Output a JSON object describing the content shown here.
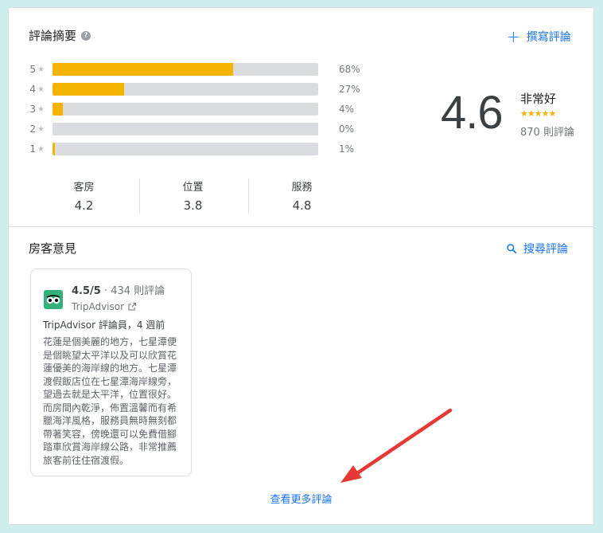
{
  "summary": {
    "title": "評論摘要",
    "write_review": "撰寫評論",
    "bars": [
      {
        "stars": "5",
        "percent_label": "68%",
        "percent": 68
      },
      {
        "stars": "4",
        "percent_label": "27%",
        "percent": 27
      },
      {
        "stars": "3",
        "percent_label": "4%",
        "percent": 4
      },
      {
        "stars": "2",
        "percent_label": "0%",
        "percent": 0
      },
      {
        "stars": "1",
        "percent_label": "1%",
        "percent": 1
      }
    ],
    "star_glyph": "★",
    "score": "4.6",
    "score_label": "非常好",
    "stars_display": "★★★★★",
    "star_rating": 4.6,
    "review_count": "870 則評論",
    "categories": [
      {
        "name": "客房",
        "value": "4.2"
      },
      {
        "name": "位置",
        "value": "3.8"
      },
      {
        "name": "服務",
        "value": "4.8"
      }
    ]
  },
  "opinions": {
    "title": "房客意見",
    "search_reviews": "搜尋評論",
    "card": {
      "rating": "4.5/5",
      "count": " · 434 則評論",
      "source": "TripAdvisor",
      "author": "TripAdvisor 評論員，4 週前",
      "text": "花蓮是個美麗的地方，七星潭便是個眺望太平洋以及可以欣賞花蓮優美的海岸線的地方。七星潭渡假飯店位在七星潭海岸線旁，望過去就是太平洋，位置很好。而房間內乾淨，佈置溫馨而有希臘海洋風格，服務員無時無刻都帶著笑容，傍晚還可以免費借腳踏車欣賞海岸線公路，非常推薦旅客前往住宿渡假。"
    },
    "more_reviews": "查看更多評論"
  },
  "colors": {
    "accent": "#1a73e8",
    "bar_fill": "#f4b400",
    "bar_track": "#dadce0",
    "annotation_arrow": "#e53935"
  }
}
